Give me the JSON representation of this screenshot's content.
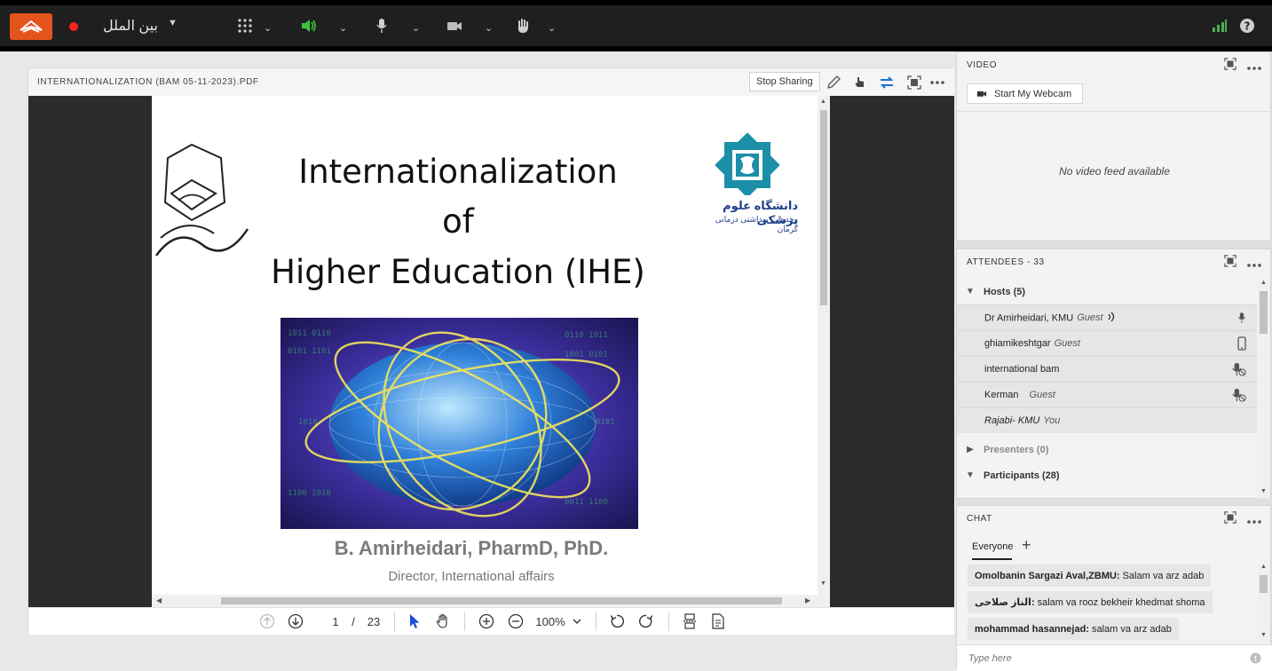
{
  "topbar": {
    "room_name": "بین الملل",
    "colors": {
      "brand": "#e3531c",
      "recording": "#ff2020",
      "audio_active": "#3ac43a",
      "signal": "#4caf50"
    }
  },
  "pod": {
    "title": "INTERNATIONALIZATION (BAM 05-11-2023).PDF",
    "stop_sharing_label": "Stop Sharing"
  },
  "slide": {
    "title_line1": "Internationalization",
    "title_line2": "of",
    "title_line3": "Higher Education (IHE)",
    "author": "B. Amirheidari, PharmD, PhD.",
    "role": "Director, International affairs",
    "logo_right_line1": "دانشگاه علوم پزشکی",
    "logo_right_line2": "وخدمات بهداشتی درمانی کرمان"
  },
  "toolbar": {
    "current_page": "1",
    "page_separator": "/",
    "total_pages": "23",
    "zoom": "100%"
  },
  "video": {
    "title": "VIDEO",
    "webcam_label": "Start My Webcam",
    "no_video_text": "No video feed available"
  },
  "attendees": {
    "title": "ATTENDEES - 33",
    "hosts_label": "Hosts (5)",
    "presenters_label": "Presenters (0)",
    "participants_label": "Participants (28)",
    "hosts": [
      {
        "name": "Dr Amirheidari, KMU",
        "role": "Guest",
        "status": "mic"
      },
      {
        "name": "ghiamikeshtgar",
        "role": "Guest",
        "status": "phone"
      },
      {
        "name": "international bam",
        "role": "",
        "status": "mic-off"
      },
      {
        "name": "Kerman",
        "role": "Guest",
        "status": "mic-off"
      },
      {
        "name": "Rajabi- KMU",
        "role": "You",
        "status": "none"
      }
    ]
  },
  "chat": {
    "title": "CHAT",
    "tab_label": "Everyone",
    "messages": [
      {
        "sender": "Omolbanin Sargazi Aval,ZBMU:",
        "text": "Salam va arz adab"
      },
      {
        "sender": "الناز صلاحی:",
        "text": "salam va rooz bekheir khedmat shoma"
      },
      {
        "sender": "mohammad hasannejad:",
        "text": "salam va arz adab"
      }
    ],
    "input_placeholder": "Type here"
  }
}
